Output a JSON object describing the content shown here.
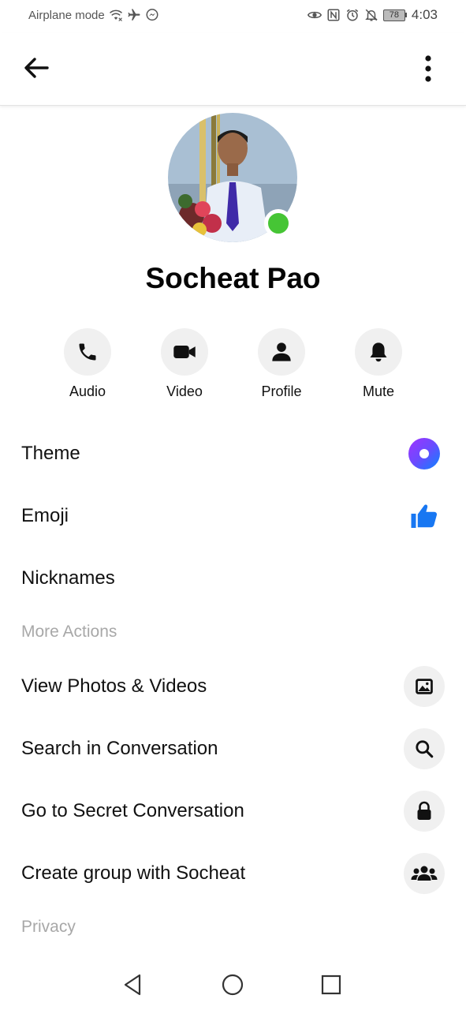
{
  "status_bar": {
    "mode_label": "Airplane mode",
    "time": "4:03",
    "battery": "78",
    "left_icons": [
      "wifi-icon",
      "airplane-icon",
      "messenger-icon"
    ],
    "right_icons": [
      "eye-icon",
      "nfc-icon",
      "alarm-icon",
      "bell-off-icon",
      "battery-icon"
    ]
  },
  "header": {
    "back_icon": "arrow-left-icon",
    "more_icon": "more-vertical-icon"
  },
  "profile": {
    "name": "Socheat Pao",
    "online": true,
    "online_color": "#46c535"
  },
  "quick_actions": [
    {
      "label": "Audio",
      "icon": "phone-icon"
    },
    {
      "label": "Video",
      "icon": "video-camera-icon"
    },
    {
      "label": "Profile",
      "icon": "person-icon"
    },
    {
      "label": "Mute",
      "icon": "bell-icon"
    }
  ],
  "customization": [
    {
      "label": "Theme",
      "icon": "theme-gradient-icon"
    },
    {
      "label": "Emoji",
      "icon": "thumbs-up-icon",
      "color": "#1877f2"
    },
    {
      "label": "Nicknames"
    }
  ],
  "more_actions": {
    "header": "More Actions",
    "items": [
      {
        "label": "View Photos & Videos",
        "icon": "photo-icon"
      },
      {
        "label": "Search in Conversation",
        "icon": "search-icon"
      },
      {
        "label": "Go to Secret Conversation",
        "icon": "lock-icon"
      },
      {
        "label": "Create group with Socheat",
        "icon": "group-icon"
      }
    ]
  },
  "privacy": {
    "header": "Privacy"
  },
  "nav_bar": {
    "icons": [
      "nav-back-icon",
      "nav-home-icon",
      "nav-recents-icon"
    ]
  },
  "colors": {
    "accent": "#1877f2",
    "section_header": "#a8a8a8",
    "icon_bg": "#f0f0f0"
  }
}
